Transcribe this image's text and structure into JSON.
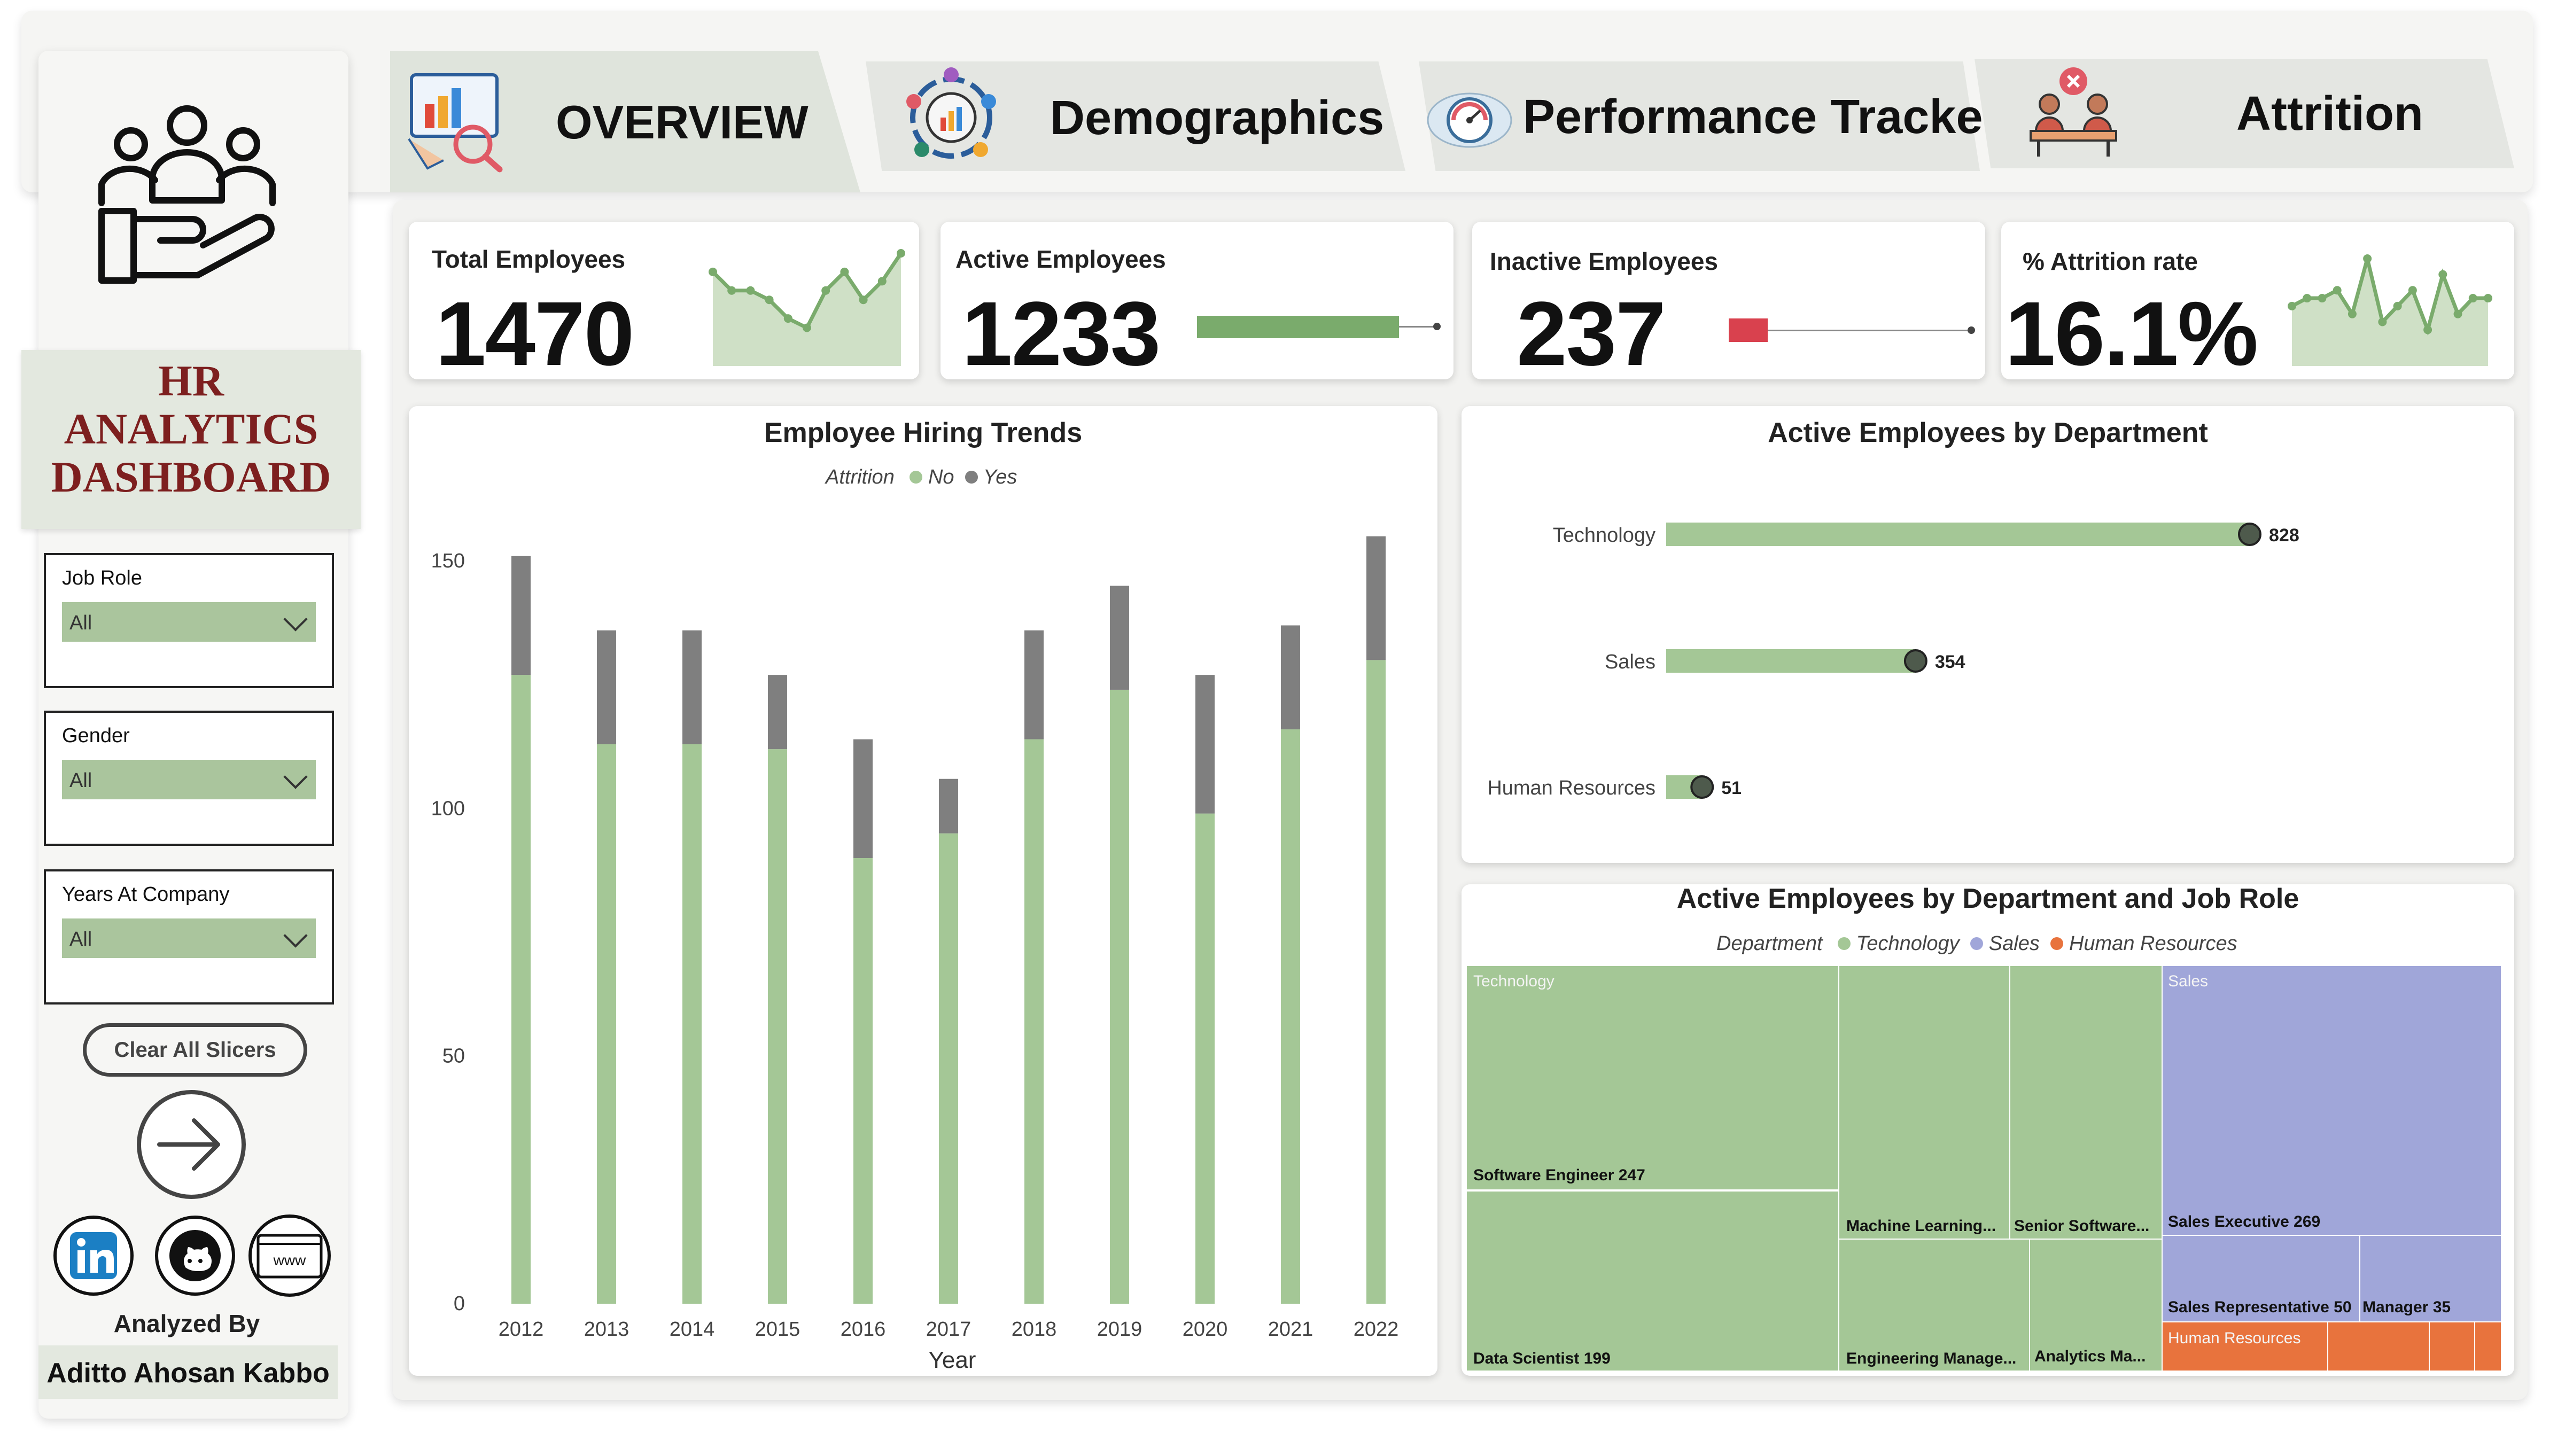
{
  "dashboard": {
    "title_lines": [
      "HR",
      "ANALYTICS",
      "DASHBOARD"
    ],
    "analyzed_by_label": "Analyzed By",
    "analyst_name": "Aditto Ahosan Kabbo",
    "clear_button": "Clear All Slicers"
  },
  "tabs": [
    {
      "label": "OVERVIEW",
      "icon": "presentation-chart-icon"
    },
    {
      "label": "Demographics",
      "icon": "people-network-icon"
    },
    {
      "label": "Performance Tracker",
      "icon": "performance-gauge-icon"
    },
    {
      "label": "Attrition",
      "icon": "employee-leaving-icon"
    }
  ],
  "slicers": [
    {
      "label": "Job Role",
      "value": "All"
    },
    {
      "label": "Gender",
      "value": "All"
    },
    {
      "label": "Years At Company",
      "value": "All"
    }
  ],
  "kpis": {
    "total": {
      "label": "Total Employees",
      "value": "1470"
    },
    "active": {
      "label": "Active Employees",
      "value": "1233"
    },
    "inactive": {
      "label": "Inactive Employees",
      "value": "237"
    },
    "attrition": {
      "label": "% Attrition rate",
      "value": "16.1%"
    }
  },
  "social": [
    "linkedin-icon",
    "github-icon",
    "website-icon"
  ],
  "colors": {
    "green": "#a4c796",
    "green_dark": "#7aab6c",
    "grey": "#7f7f7f",
    "purple": "#a0a6d9",
    "orange": "#e8733d",
    "red": "#d9414e",
    "title_red": "#7d1f1f"
  },
  "chart_data": [
    {
      "type": "bar",
      "title": "Employee Hiring Trends",
      "xlabel": "Year",
      "ylabel": "",
      "legend_title": "Attrition",
      "categories": [
        "2012",
        "2013",
        "2014",
        "2015",
        "2016",
        "2017",
        "2018",
        "2019",
        "2020",
        "2021",
        "2022"
      ],
      "series": [
        {
          "name": "No",
          "values": [
            127,
            113,
            113,
            112,
            90,
            95,
            114,
            124,
            99,
            116,
            130
          ]
        },
        {
          "name": "Yes",
          "values": [
            24,
            23,
            23,
            15,
            24,
            11,
            22,
            21,
            28,
            21,
            25
          ]
        }
      ],
      "stacked": true,
      "yticks": [
        0,
        50,
        100,
        150
      ],
      "ylim": [
        0,
        165
      ]
    },
    {
      "type": "bar",
      "orientation": "horizontal",
      "title": "Active Employees by Department",
      "categories": [
        "Technology",
        "Sales",
        "Human Resources"
      ],
      "values": [
        828,
        354,
        51
      ],
      "xlim": [
        0,
        850
      ]
    },
    {
      "type": "treemap",
      "title": "Active Employees by Department and Job Role",
      "legend_title": "Department",
      "legend": [
        "Technology",
        "Sales",
        "Human Resources"
      ],
      "groups": [
        {
          "name": "Technology",
          "items": [
            {
              "label": "Software Engineer 247",
              "value": 247
            },
            {
              "label": "Data Scientist 199",
              "value": 199
            },
            {
              "label": "Machine Learning...",
              "value": 0
            },
            {
              "label": "Senior Software...",
              "value": 0
            },
            {
              "label": "Engineering Manage...",
              "value": 0
            },
            {
              "label": "Analytics Ma...",
              "value": 0
            }
          ]
        },
        {
          "name": "Sales",
          "items": [
            {
              "label": "Sales Executive 269",
              "value": 269
            },
            {
              "label": "Sales Representative 50",
              "value": 50
            },
            {
              "label": "Manager 35",
              "value": 35
            }
          ]
        },
        {
          "name": "Human Resources",
          "items": []
        }
      ]
    },
    {
      "type": "line",
      "title": "",
      "sparklines": {
        "total": [
          8,
          6,
          6,
          5,
          3,
          2,
          6,
          8,
          5,
          7,
          10
        ],
        "attrition": [
          4,
          5,
          5,
          6,
          3,
          10,
          2,
          4,
          6,
          1,
          8,
          3,
          5,
          5
        ]
      }
    }
  ]
}
